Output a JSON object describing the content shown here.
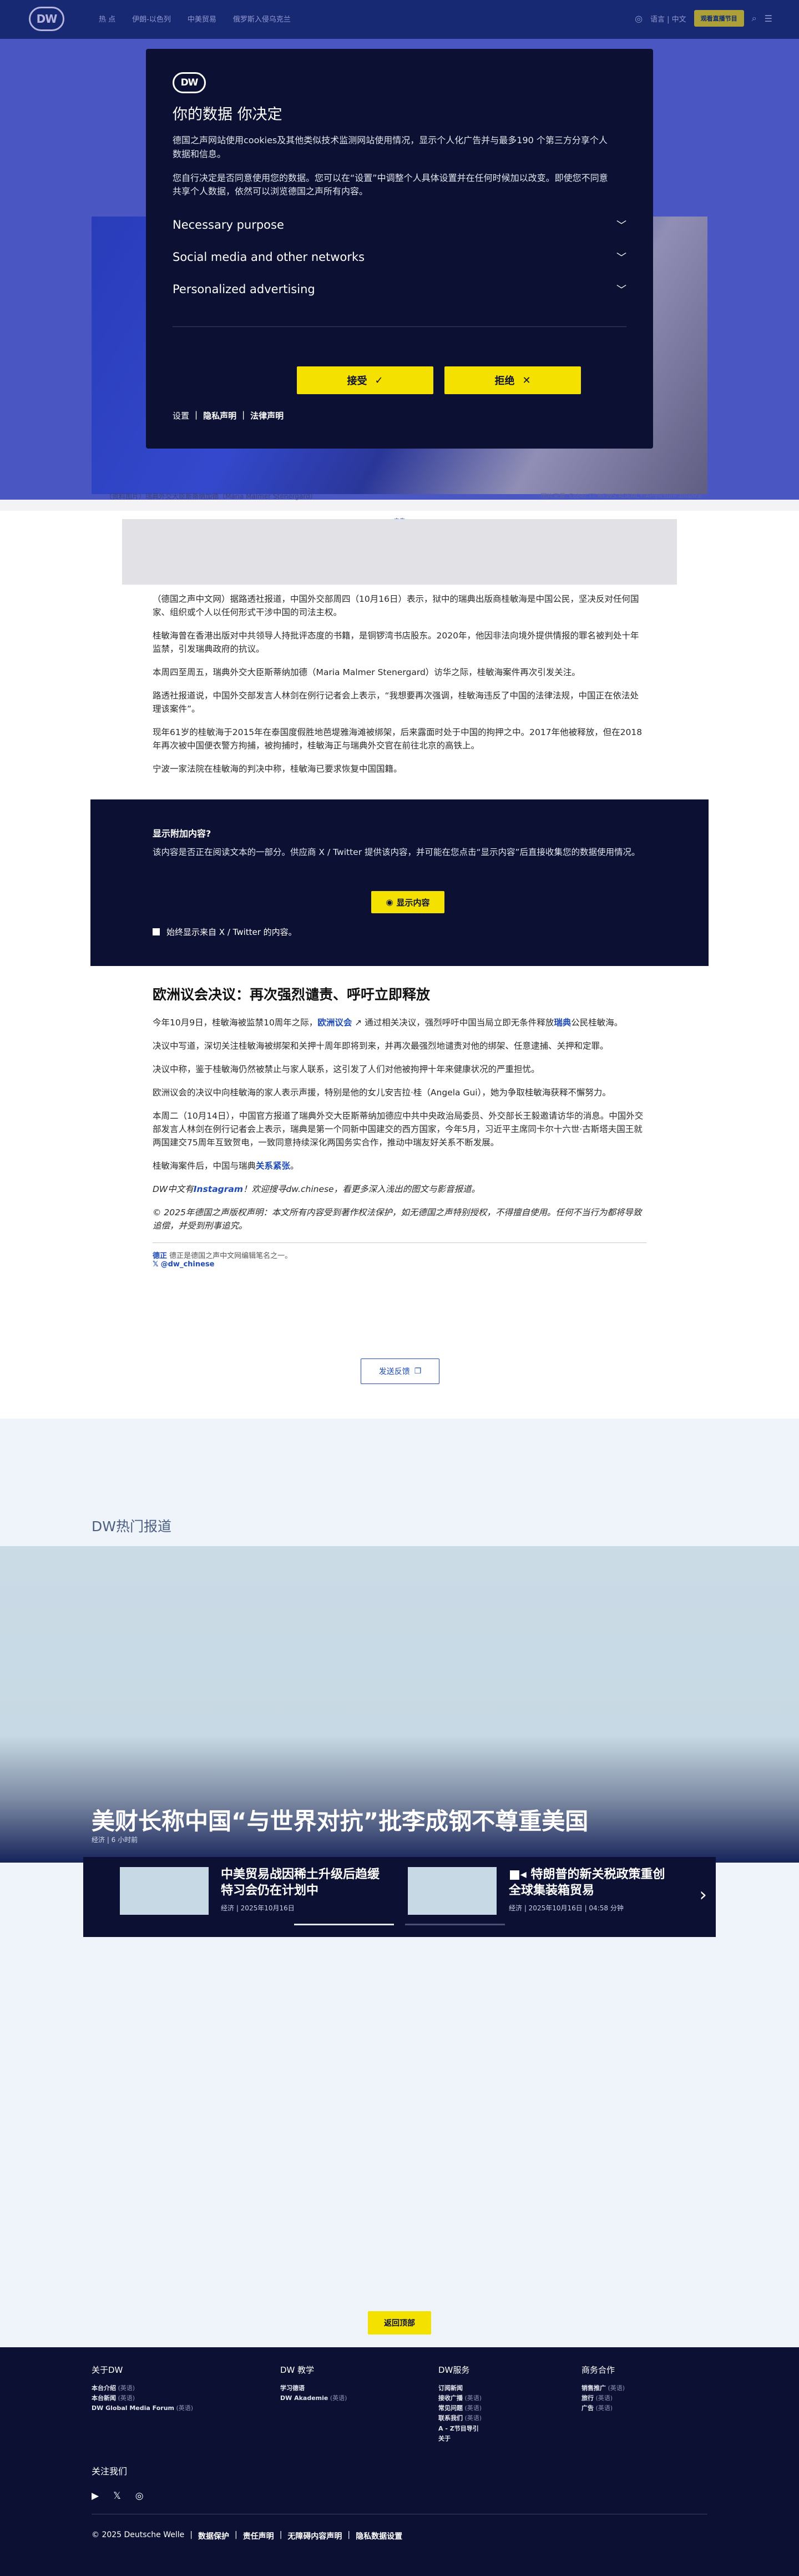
{
  "header": {
    "logo": "DW",
    "nav": [
      "热 点",
      "伊朗-以色列",
      "中美贸易",
      "俄罗斯入侵乌克兰"
    ],
    "lang_label": "语言 | 中文",
    "live_button": "观看直播节目"
  },
  "hero": {
    "caption": "（资料图片）瑞典外交大臣斯蒂纳加德（Maria Malmer Stenergard）",
    "credit": "图片来源: Ebbe/ TT NEWS AGENCY/AP/picture alliance"
  },
  "cookie": {
    "logo": "DW",
    "title": "你的数据 你决定",
    "text1": "德国之声网站使用cookies及其他类似技术监测网站使用情况，显示个人化广告并与最多190 个第三方分享个人数据和信息。",
    "text2": "您自行决定是否同意使用您的数据。您可以在“设置”中调整个人具体设置并在任何时候加以改变。即使您不同意共享个人数据，依然可以浏览德国之声所有内容。",
    "sections": [
      "Necessary purpose",
      "Social media and other networks",
      "Personalized advertising"
    ],
    "accept": "接受",
    "reject": "拒绝",
    "links": [
      "设置",
      "隐私声明",
      "法律声明"
    ]
  },
  "ad_label": "广告",
  "article": {
    "p1": "（德国之声中文网）据路透社报道，中国外交部周四（10月16日）表示，狱中的瑞典出版商桂敏海是中国公民，坚决反对任何国家、组织或个人以任何形式干涉中国的司法主权。",
    "p2": "桂敏海曾在香港出版对中共领导人持批评态度的书籍，是铜锣湾书店股东。2020年，他因非法向境外提供情报的罪名被判处十年监禁，引发瑞典政府的抗议。",
    "p3": "本周四至周五，瑞典外交大臣斯蒂纳加德（Maria Malmer Stenergard）访华之际，桂敏海案件再次引发关注。",
    "p4": "路透社报道说，中国外交部发言人林剑在例行记者会上表示，“我想要再次强调，桂敏海违反了中国的法律法规，中国正在依法处理该案件”。",
    "p5": "现年61岁的桂敏海于2015年在泰国度假胜地芭堤雅海滩被绑架，后来露面时处于中国的拘押之中。2017年他被释放，但在2018年再次被中国便衣警方拘捕，被拘捕时，桂敏海正与瑞典外交官在前往北京的高铁上。",
    "p6": "宁波一家法院在桂敏海的判决中称，桂敏海已要求恢复中国国籍。"
  },
  "embed": {
    "title": "显示附加内容?",
    "desc": "该内容是否正在阅读文本的一部分。供应商 X / Twitter 提供该内容，并可能在您点击“显示内容”后直接收集您的数据使用情况。",
    "button": "显示内容",
    "checkbox": "始终显示来自 X / Twitter 的内容。"
  },
  "article2": {
    "heading": "欧洲议会决议：再次强烈谴责、呼吁立即释放",
    "p1_a": "今年10月9日，桂敏海被监禁10周年之际，",
    "p1_link": "欧洲议会",
    "p1_b": "通过相关决议，强烈呼吁中国当局立即无条件释放",
    "p1_link2": "瑞典",
    "p1_c": "公民桂敏海。",
    "p2": "决议中写道，深切关注桂敏海被绑架和关押十周年即将到来，并再次最强烈地谴责对他的绑架、任意逮捕、关押和定罪。",
    "p3": "决议中称，鉴于桂敏海仍然被禁止与家人联系，这引发了人们对他被拘押十年来健康状况的严重担忧。",
    "p4": "欧洲议会的决议中向桂敏海的家人表示声援，特别是他的女儿安吉拉·桂（Angela Gui），她为争取桂敏海获释不懈努力。",
    "p5": "本周二（10月14日），中国官方报道了瑞典外交大臣斯蒂纳加德应中共中央政治局委员、外交部长王毅邀请访华的消息。中国外交部发言人林剑在例行记者会上表示，瑞典是第一个同新中国建交的西方国家，今年5月，习近平主席同卡尔十六世·古斯塔夫国王就两国建交75周年互致贺电，一致同意持续深化两国务实合作，推动中瑞友好关系不断发展。",
    "p6_a": "桂敏海案件后，中国与瑞典",
    "p6_link": "关系紧张",
    "p6_b": "。",
    "p7_a": "DW中文有",
    "p7_link": "Instagram",
    "p7_b": "！欢迎搜寻dw.chinese，看更多深入浅出的图文与影音报道。",
    "p8": "© 2025年德国之声版权声明：本文所有内容受到著作权法保护，如无德国之声特别授权，不得擅自使用。任何不当行为都将导致追偿，并受到刑事追究。",
    "author_name": "德正",
    "author_role": "德正是德国之声中文网编辑笔名之一。",
    "author_social": "@dw_chinese",
    "feedback": "发送反馈"
  },
  "trending": {
    "section_title": "DW热门报道",
    "headline": "美财长称中国“与世界对抗”批李成钢不尊重美国",
    "meta": "经济 | 6 小时前",
    "cards": [
      {
        "title": "中美贸易战因稀土升级后趋缓 特习会仍在计划中",
        "meta": "经济 | 2025年10月16日"
      },
      {
        "title": "特朗普的新关税政策重创全球集装箱贸易",
        "meta": "经济 | 2025年10月16日 | 04:58 分钟"
      }
    ]
  },
  "back_top": "返回顶部",
  "footer": {
    "col1_title": "关于DW",
    "col1": [
      [
        "本台介绍",
        "(英语)"
      ],
      [
        "本台新闻",
        "(英语)"
      ],
      [
        "DW Global Media Forum",
        "(英语)"
      ]
    ],
    "col2_title": "DW 教学",
    "col2": [
      [
        "学习德语",
        ""
      ],
      [
        "DW Akademie",
        "(英语)"
      ]
    ],
    "col3_title": "DW服务",
    "col3": [
      [
        "订阅新闻",
        ""
      ],
      [
        "接收广播",
        "(英语)"
      ],
      [
        "常见问题",
        "(英语)"
      ],
      [
        "联系我们",
        "(英语)"
      ],
      [
        "A - Z节目导引",
        ""
      ],
      [
        "关于",
        ""
      ]
    ],
    "col4_title": "商务合作",
    "col4": [
      [
        "销售推广",
        "(英语)"
      ],
      [
        "旅行",
        "(英语)"
      ],
      [
        "广告",
        "(英语)"
      ]
    ],
    "follow": "关注我们",
    "social": [
      "youtube",
      "x",
      "instagram"
    ],
    "legal": [
      "© 2025 Deutsche Welle",
      "数据保护",
      "责任声明",
      "无障碍内容声明",
      "隐私数据设置"
    ]
  }
}
